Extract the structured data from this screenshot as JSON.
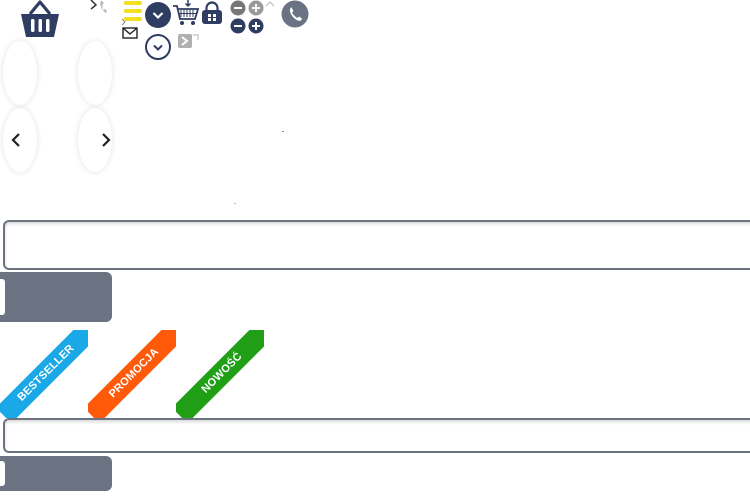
{
  "header": {
    "cart_icon": "basket-icon",
    "menu_icon": "hamburger-icon",
    "colors": {
      "navy": "#2f3d63",
      "yellow": "#f2e01b",
      "gray": "#6b7383"
    }
  },
  "ribbons": [
    {
      "label": "BESTSELLER",
      "color": "#1aa9e6"
    },
    {
      "label": "PROMOCJA",
      "color": "#ff5a0a"
    },
    {
      "label": "NOWOŚĆ",
      "color": "#1f9e16"
    }
  ],
  "search1": {
    "value": "",
    "placeholder": ""
  },
  "search2": {
    "value": "",
    "placeholder": ""
  },
  "buttons": {
    "submit1_label": "",
    "submit2_label": ""
  }
}
